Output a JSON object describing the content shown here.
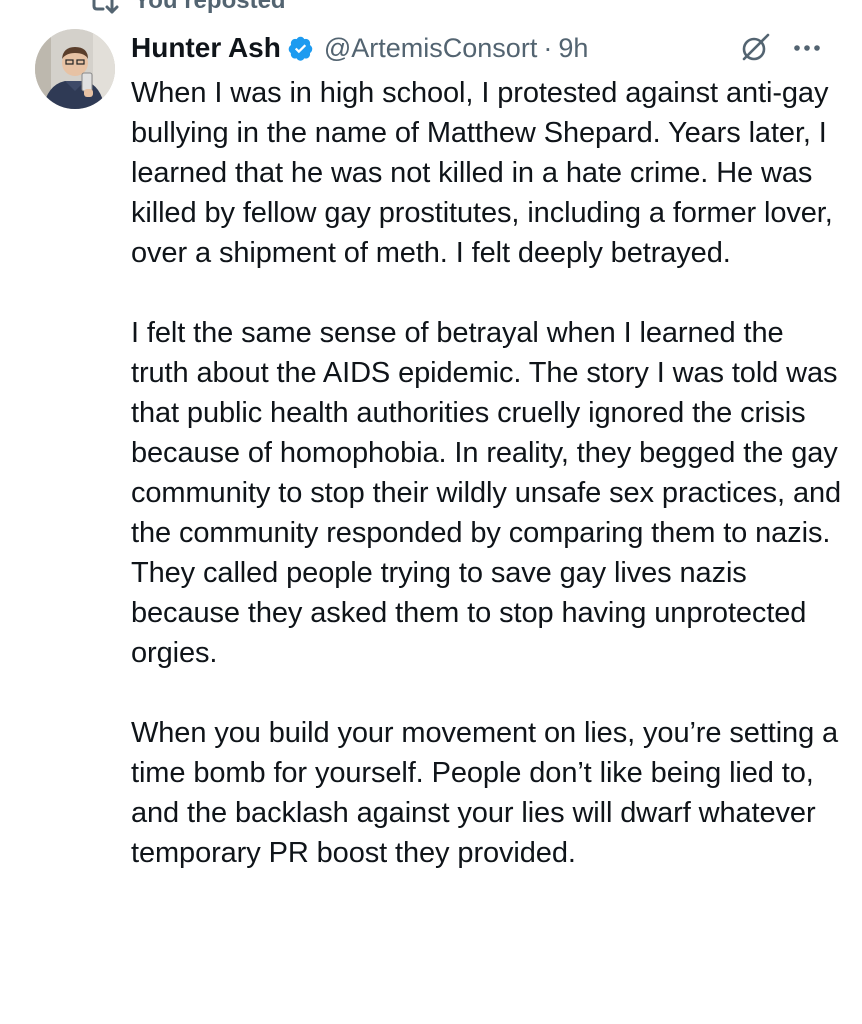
{
  "repost_banner": {
    "icon": "repost-icon",
    "label": "You reposted"
  },
  "author": {
    "display_name": "Hunter Ash",
    "verified": true,
    "verified_icon": "verified-badge-icon",
    "verified_color": "#1d9bf0",
    "handle": "@ArtemisConsort",
    "separator": "·",
    "time": "9h"
  },
  "header_actions": {
    "grok_icon": "grok-icon",
    "more_icon": "more-options-icon"
  },
  "tweet": {
    "paragraphs": [
      "When I was in high school, I protested against anti-gay bullying in the name of Matthew Shepard. Years later, I learned that he was not killed in a hate crime. He was killed by fellow gay prostitutes, including a former lover, over a shipment of meth. I felt deeply betrayed.",
      "I felt the same sense of betrayal when I learned the truth about the AIDS epidemic. The story I was told was that public health authorities cruelly ignored the crisis because of homophobia. In reality, they begged the gay community to stop their wildly unsafe sex practices, and the community responded by comparing them to nazis. They called people trying to save gay lives nazis because they asked them to stop having unprotected orgies.",
      "When you build your movement on lies, you’re setting a time bomb for yourself. People don’t like being lied to, and the backlash against your lies will dwarf whatever temporary PR boost they provided."
    ]
  },
  "colors": {
    "text_primary": "#0f1419",
    "text_secondary": "#536471",
    "accent": "#1d9bf0",
    "background": "#ffffff"
  }
}
